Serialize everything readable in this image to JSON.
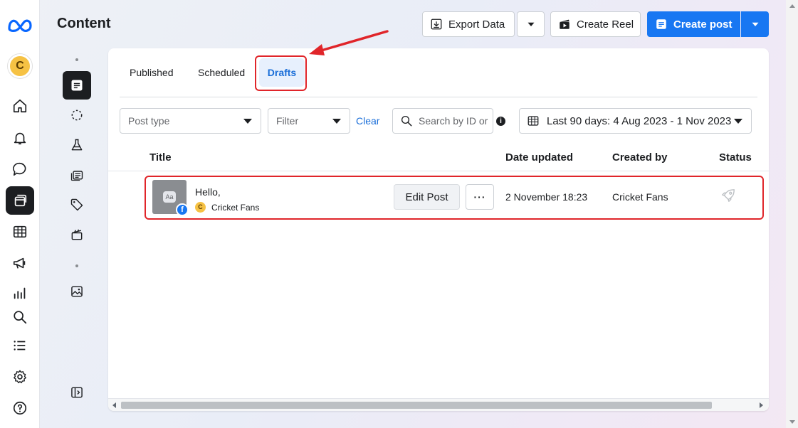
{
  "rail": {
    "logo_icon": "meta-logo-icon",
    "avatar_letter": "C",
    "items": [
      "home-icon",
      "bell-icon",
      "chat-icon",
      "content-icon",
      "calendar-grid-icon",
      "megaphone-icon",
      "insights-icon",
      "search-icon",
      "list-icon",
      "gear-icon",
      "help-icon"
    ]
  },
  "subrail": {
    "items": [
      "posts-icon",
      "loading-circle-icon",
      "flask-icon",
      "ads-icon",
      "tag-icon",
      "clapperboard-icon",
      "image-icon",
      "panel-toggle-icon"
    ]
  },
  "header": {
    "title": "Content",
    "export_label": "Export Data",
    "reel_label": "Create Reel",
    "create_label": "Create post"
  },
  "tabs": [
    {
      "label": "Published"
    },
    {
      "label": "Scheduled"
    },
    {
      "label": "Drafts",
      "active": true
    }
  ],
  "filters": {
    "post_type_placeholder": "Post type",
    "filter_placeholder": "Filter",
    "clear_label": "Clear",
    "search_placeholder": "Search by ID or",
    "info_glyph": "i",
    "date_range": "Last 90 days: 4 Aug 2023 - 1 Nov 2023"
  },
  "table": {
    "columns": [
      "Title",
      "Date updated",
      "Created by",
      "Status"
    ],
    "rows": [
      {
        "thumb_label": "Aa",
        "badge": "f",
        "text": "Hello,",
        "page_initial": "C",
        "page_name": "Cricket Fans",
        "edit_label": "Edit Post",
        "more_label": "···",
        "date_updated": "2 November 18:23",
        "created_by": "Cricket Fans",
        "status_icon": "rocket-icon"
      }
    ]
  },
  "colors": {
    "accent": "#1877f2",
    "active_tab_text": "#1a6ed8",
    "active_tab_bg": "#e7f0fd",
    "annotation": "#e0252a"
  }
}
